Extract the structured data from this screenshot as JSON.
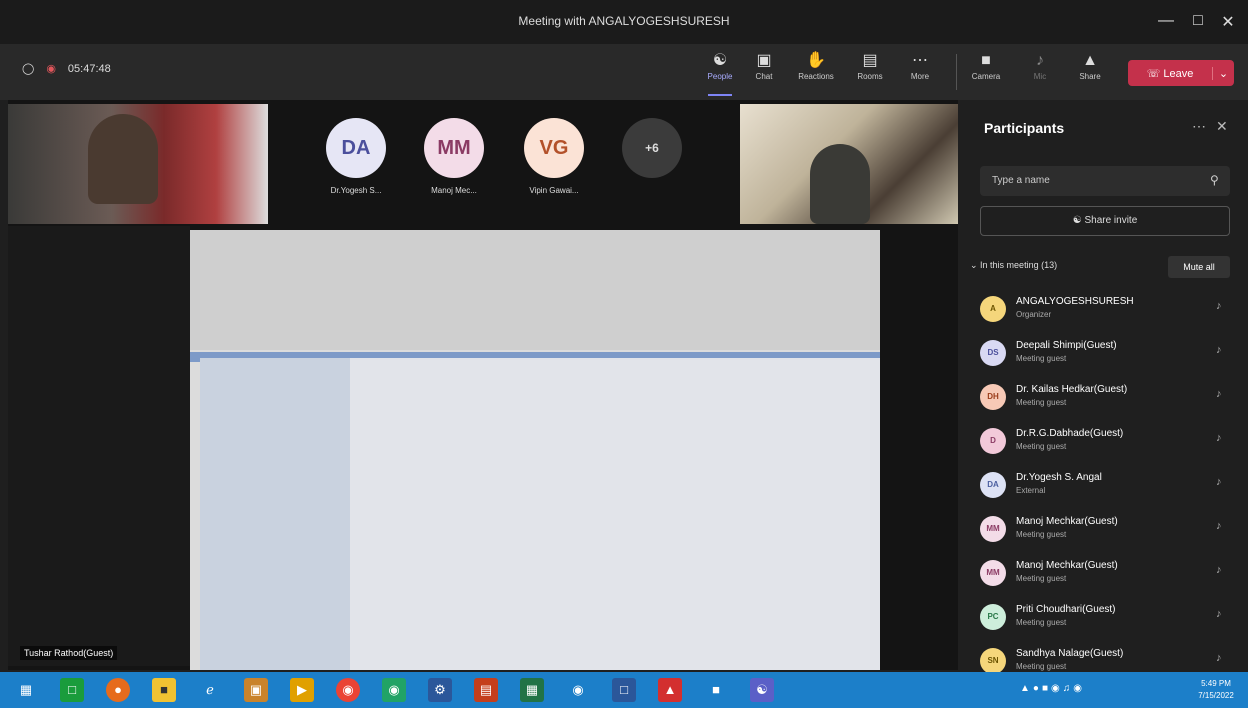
{
  "window": {
    "title": "Meeting with ANGALYOGESHSURESH"
  },
  "toolbar": {
    "timer": "05:47:48",
    "buttons": [
      {
        "label": "People",
        "icon": "people-icon"
      },
      {
        "label": "Chat",
        "icon": "chat-icon"
      },
      {
        "label": "Reactions",
        "icon": "reactions-icon"
      },
      {
        "label": "Rooms",
        "icon": "rooms-icon"
      },
      {
        "label": "More",
        "icon": "more-icon"
      },
      {
        "label": "Camera",
        "icon": "camera-icon"
      },
      {
        "label": "Mic",
        "icon": "mic-icon"
      },
      {
        "label": "Share",
        "icon": "share-icon"
      }
    ],
    "leave_label": "Leave"
  },
  "stage": {
    "avatars": [
      {
        "initials": "DA",
        "name": "Dr.Yogesh S...",
        "bg": "#e6e6f5",
        "fg": "#4b4f9c"
      },
      {
        "initials": "MM",
        "name": "Manoj Mec...",
        "bg": "#f3dce8",
        "fg": "#8b3b64"
      },
      {
        "initials": "VG",
        "name": "Vipin Gawai...",
        "bg": "#fbe3d6",
        "fg": "#b3512a"
      }
    ],
    "overflow": "+6",
    "presenter_name": "Tushar Rathod(Guest)"
  },
  "panel": {
    "title": "Participants",
    "search_placeholder": "Type a name",
    "share_invite": "Share invite",
    "meeting_header": "In this meeting (13)",
    "mute_all": "Mute all",
    "participants": [
      {
        "initials": "A",
        "name": "ANGALYOGESHSURESH",
        "role": "Organizer",
        "bg": "#f5d67b",
        "fg": "#6b5300"
      },
      {
        "initials": "DS",
        "name": "Deepali Shimpi(Guest)",
        "role": "Meeting guest",
        "bg": "#d9d9f3",
        "fg": "#4b4f9c"
      },
      {
        "initials": "DH",
        "name": "Dr. Kailas Hedkar(Guest)",
        "role": "Meeting guest",
        "bg": "#f7c9b6",
        "fg": "#9b3d1b"
      },
      {
        "initials": "D",
        "name": "Dr.R.G.Dabhade(Guest)",
        "role": "Meeting guest",
        "bg": "#f2c9d9",
        "fg": "#8b3b64"
      },
      {
        "initials": "DA",
        "name": "Dr.Yogesh S. Angal",
        "role": "External",
        "bg": "#dde2f5",
        "fg": "#4b5fa0"
      },
      {
        "initials": "MM",
        "name": "Manoj Mechkar(Guest)",
        "role": "Meeting guest",
        "bg": "#f3dce8",
        "fg": "#8b3b64"
      },
      {
        "initials": "MM",
        "name": "Manoj Mechkar(Guest)",
        "role": "Meeting guest",
        "bg": "#f3dce8",
        "fg": "#8b3b64"
      },
      {
        "initials": "PC",
        "name": "Priti Choudhari(Guest)",
        "role": "Meeting guest",
        "bg": "#cdeedb",
        "fg": "#2b7a4b"
      },
      {
        "initials": "SN",
        "name": "Sandhya Nalage(Guest)",
        "role": "Meeting guest",
        "bg": "#f5d67b",
        "fg": "#6b5300"
      }
    ]
  },
  "taskbar": {
    "clock_time": "5:49 PM",
    "clock_date": "7/15/2022"
  },
  "colors": {
    "accent": "#7f85f5",
    "leave": "#c4314b",
    "taskbar": "#1c7fc9"
  }
}
